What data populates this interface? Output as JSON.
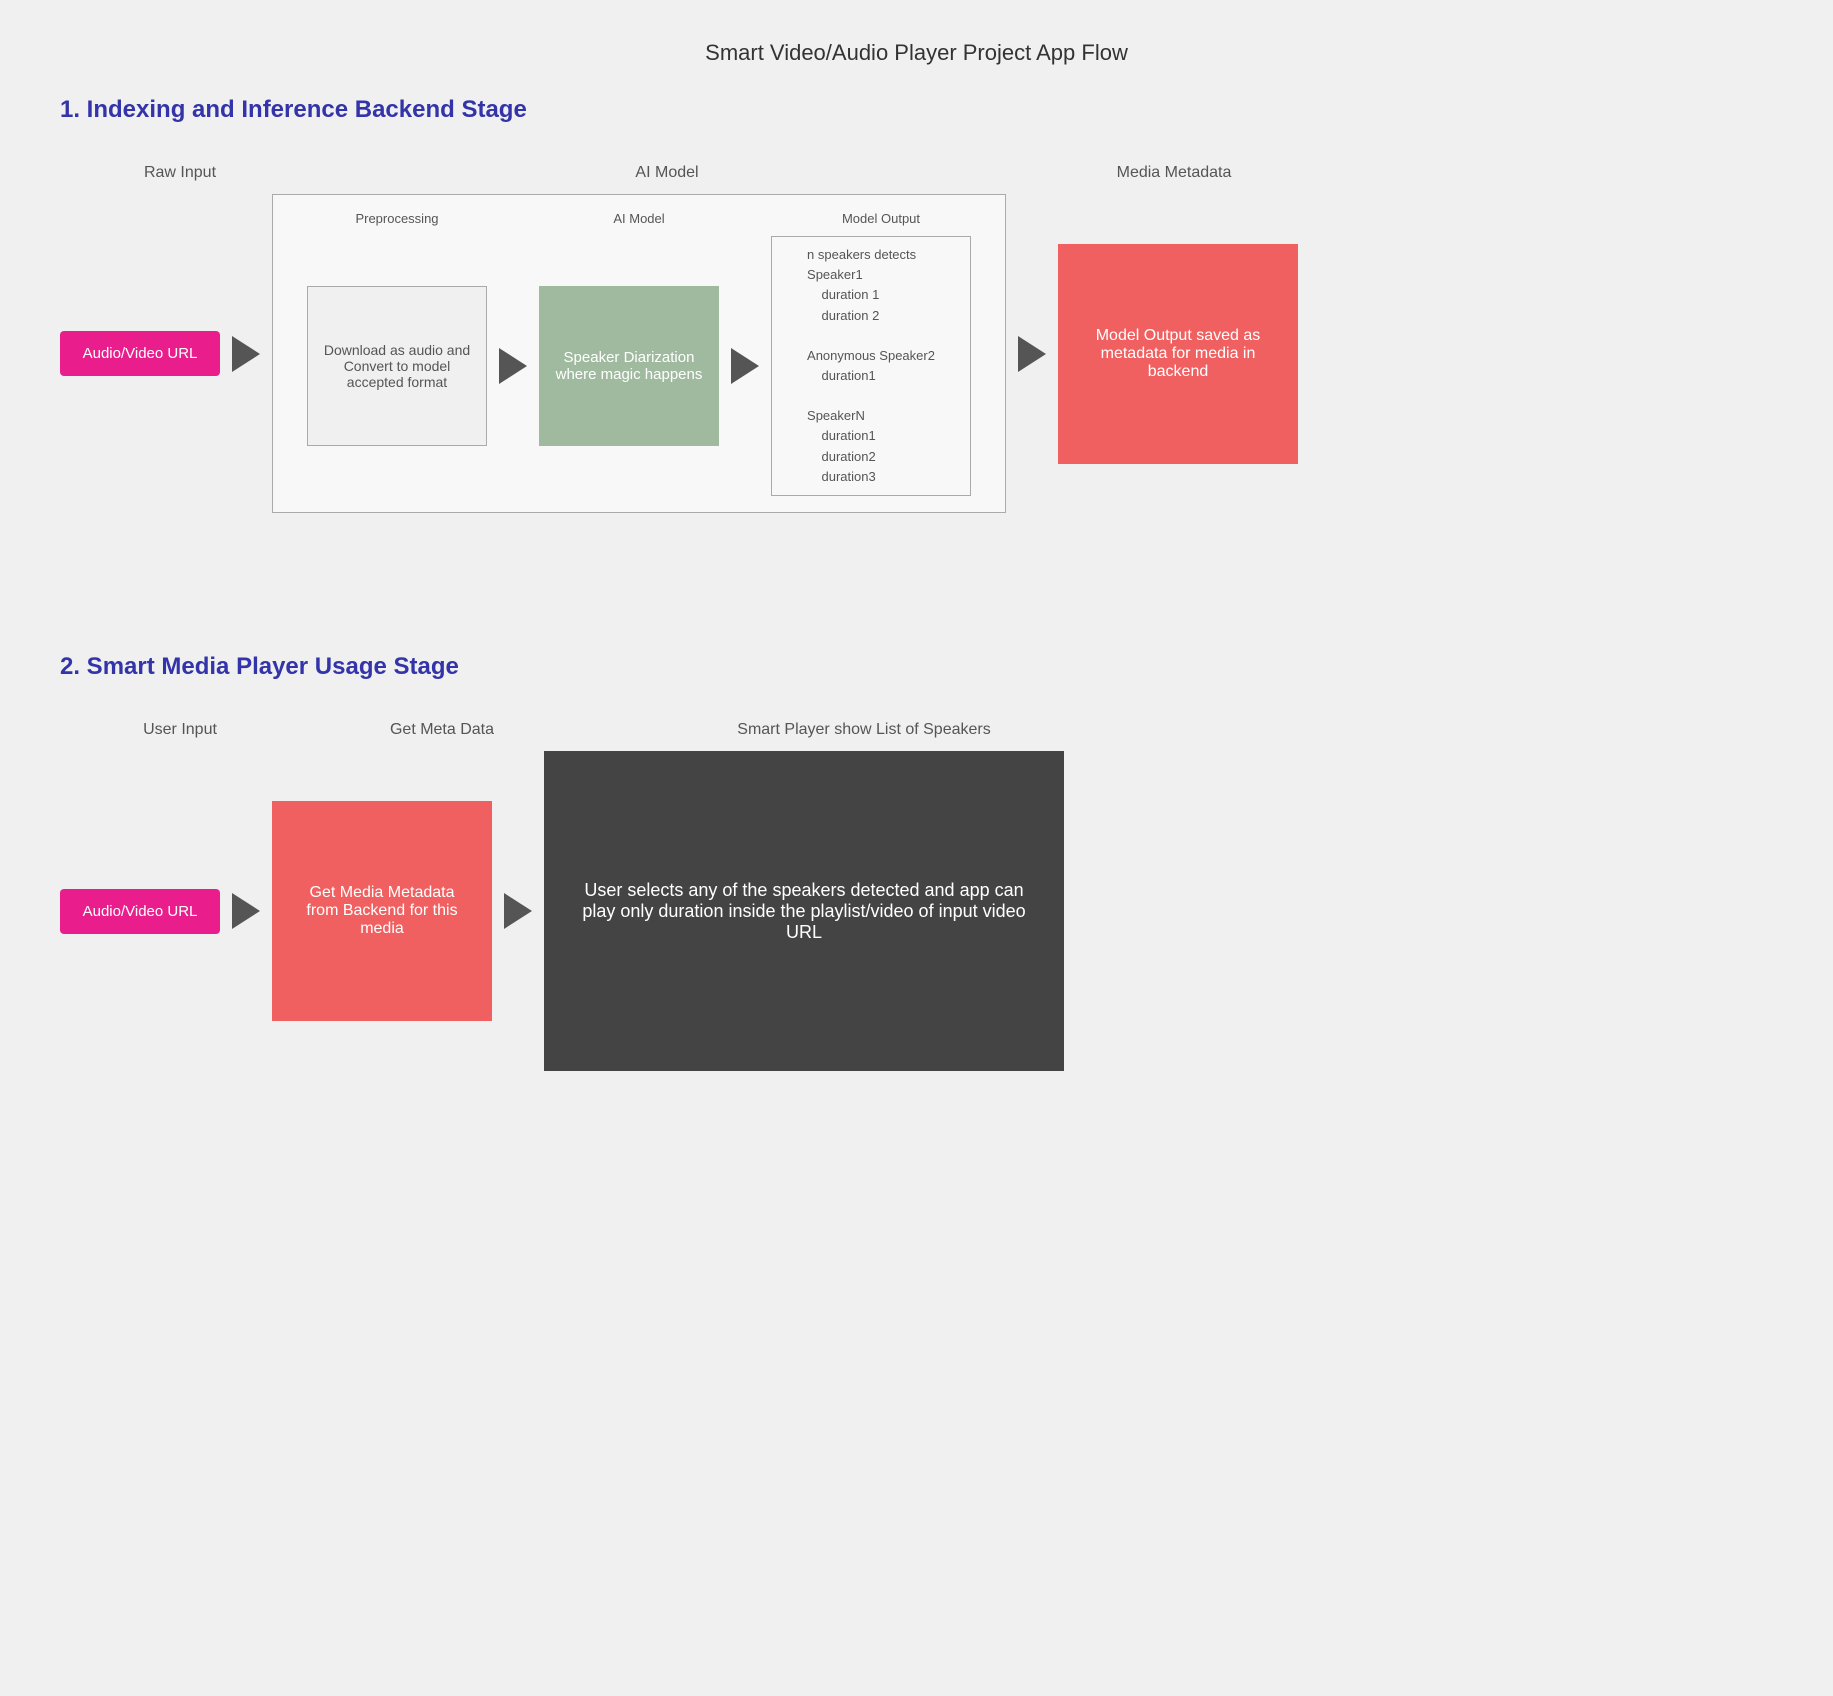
{
  "page": {
    "title": "Smart Video/Audio Player Project App Flow"
  },
  "stage1": {
    "title": "1. Indexing and Inference Backend Stage",
    "col_labels": {
      "raw_input": "Raw Input",
      "ai_model": "AI Model",
      "media_metadata": "Media Metadata"
    },
    "url_btn": "Audio/Video URL",
    "preprocessing": {
      "label": "Preprocessing",
      "text": "Download as audio and\nConvert to model accepted format"
    },
    "ai_model": {
      "label": "AI Model",
      "text": "Speaker Diarization\nwhere magic happens"
    },
    "model_output": {
      "label": "Model Output",
      "lines": [
        "n speakers detects",
        "Speaker1",
        "    duration 1",
        "    duration 2",
        "",
        "Anonymous Speaker2",
        "    duration1",
        "",
        "SpeakerN",
        "    duration1",
        "    duration2",
        "    duration3"
      ]
    },
    "metadata_box": {
      "text": "Model Output saved as metadata for media in backend"
    }
  },
  "stage2": {
    "title": "2. Smart Media Player Usage Stage",
    "col_labels": {
      "user_input": "User Input",
      "get_meta_data": "Get Meta Data",
      "smart_player": "Smart Player show List of Speakers"
    },
    "url_btn": "Audio/Video URL",
    "get_metadata_box": {
      "text": "Get Media Metadata\nfrom Backend for this media"
    },
    "smart_player_box": {
      "text": "User selects any of the speakers detected and app can play only duration inside the playlist/video of input video URL"
    }
  }
}
